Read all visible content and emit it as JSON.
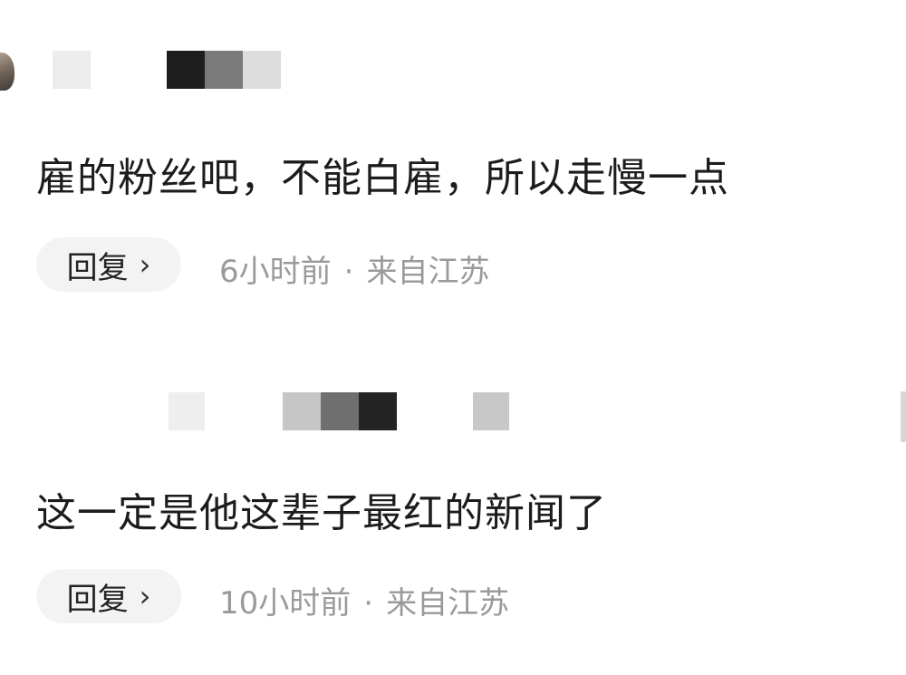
{
  "comments": [
    {
      "text": "雇的粉丝吧，不能白雇，所以走慢一点",
      "reply_label": "回复",
      "reply_chevron": "›",
      "time": "6小时前",
      "separator": "·",
      "location": "来自江苏"
    },
    {
      "text": "这一定是他这辈子最红的新闻了",
      "reply_label": "回复",
      "reply_chevron": "›",
      "time": "10小时前",
      "separator": "·",
      "location": "来自江苏"
    }
  ],
  "colors": {
    "text": "#1c1c1c",
    "meta": "#9a9a9a",
    "reply_bg": "#f3f3f3",
    "background": "#ffffff"
  },
  "icons": {
    "chevron": "chevron-right-icon"
  }
}
